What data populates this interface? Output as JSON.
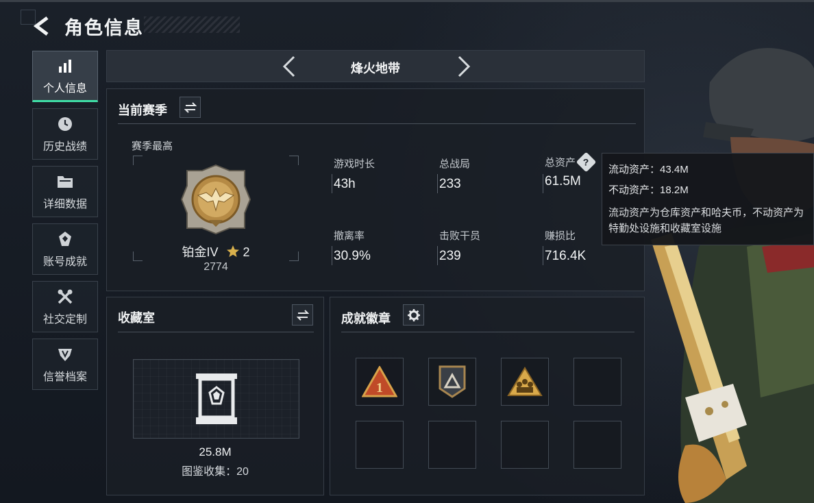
{
  "header": {
    "title": "角色信息"
  },
  "sidebar": {
    "items": [
      {
        "label": "个人信息",
        "icon": "bar-chart-icon",
        "active": true
      },
      {
        "label": "历史战绩",
        "icon": "clock-icon",
        "active": false
      },
      {
        "label": "详细数据",
        "icon": "folder-icon",
        "active": false
      },
      {
        "label": "账号成就",
        "icon": "gem-badge-icon",
        "active": false
      },
      {
        "label": "社交定制",
        "icon": "tools-icon",
        "active": false
      },
      {
        "label": "信誉档案",
        "icon": "shield-icon",
        "active": false
      }
    ]
  },
  "mode": {
    "name": "烽火地带"
  },
  "season": {
    "title": "当前赛季",
    "best_label": "赛季最高",
    "rank_name": "铂金IV",
    "rank_stars": "2",
    "rank_score": "2774",
    "stats": [
      {
        "label": "游戏时长",
        "value": "43h"
      },
      {
        "label": "总战局",
        "value": "233"
      },
      {
        "label": "总资产",
        "value": "61.5M",
        "help": true
      },
      {
        "label": "撤离率",
        "value": "30.9%"
      },
      {
        "label": "击败干员",
        "value": "239"
      },
      {
        "label": "赚损比",
        "value": "716.4K"
      }
    ]
  },
  "tooltip": {
    "liquid": "流动资产：43.4M",
    "fixed": "不动资产：18.2M",
    "desc": "流动资产为仓库资产和哈夫币，不动资产为特勤处设施和收藏室设施"
  },
  "collection": {
    "title": "收藏室",
    "value": "25.8M",
    "count": "图鉴收集：20"
  },
  "achievements": {
    "title": "成就徽章",
    "medals": [
      {
        "icon": "triangle-medal-1-icon",
        "filled": true
      },
      {
        "icon": "chevron-medal-icon",
        "filled": true
      },
      {
        "icon": "soldiers-medal-icon",
        "filled": true
      },
      {
        "filled": false
      },
      {
        "filled": false
      },
      {
        "filled": false
      },
      {
        "filled": false
      },
      {
        "filled": false
      }
    ]
  },
  "colors": {
    "accent": "#3fe0a8",
    "gold": "#c9a24a"
  }
}
